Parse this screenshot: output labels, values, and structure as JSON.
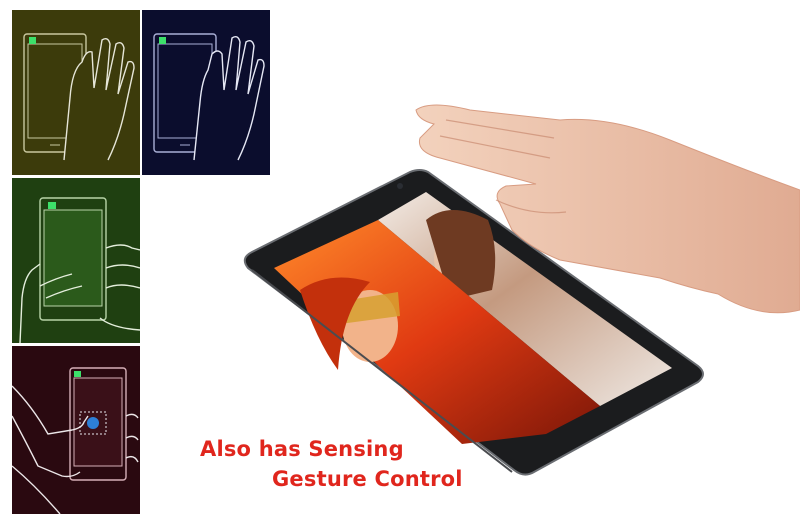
{
  "caption": {
    "line1": "Also has Sensing",
    "line2": "Gesture Control"
  },
  "colors": {
    "caption": "#e0261d",
    "panel_yellow": "#3c3b0b",
    "panel_blue": "#0b0d2d",
    "panel_green": "#1f4011",
    "panel_red": "#2a0910",
    "phone_body": "#1b1c1e"
  },
  "icons": [
    "wave-hand-icon",
    "hold-phone-icon",
    "tap-hand-icon"
  ]
}
